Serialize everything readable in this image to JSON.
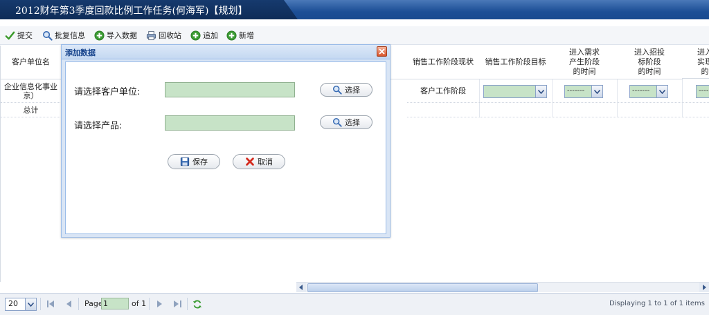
{
  "window": {
    "title": "2012财年第3季度回款比例工作任务(何海军)【规划】"
  },
  "toolbar": {
    "submit": "提交",
    "review_info": "批复信息",
    "import_data": "导入数据",
    "recycle_bin": "回收站",
    "append": "追加",
    "add_new": "新增"
  },
  "grid": {
    "headers": {
      "client_unit": "客户单位名",
      "current_stage": "销售工作阶段现状",
      "target_stage": "销售工作阶段目标",
      "demand_stage_time": "进入需求\n产生阶段\n的时间",
      "bidding_stage_time": "进入招投\n标阶段\n的时间",
      "partial_next": "进入\n实现\n的"
    },
    "rows": [
      {
        "client_unit": "企业信息化事业\n京）",
        "current_stage": "客户工作阶段",
        "demand_combo": "-------",
        "bidding_combo": "-------",
        "next_combo": "----"
      },
      {
        "client_unit": "总计"
      }
    ]
  },
  "dialog": {
    "title": "添加数据",
    "client_label": "请选择客户单位:",
    "product_label": "请选择产品:",
    "select_label": "选择",
    "save_label": "保存",
    "cancel_label": "取消",
    "client_value": "",
    "product_value": ""
  },
  "pager": {
    "page_size": "20",
    "page_label": "Page",
    "page_value": "1",
    "of_label": "of 1",
    "display_text": "Displaying 1 to 1 of 1 items"
  }
}
